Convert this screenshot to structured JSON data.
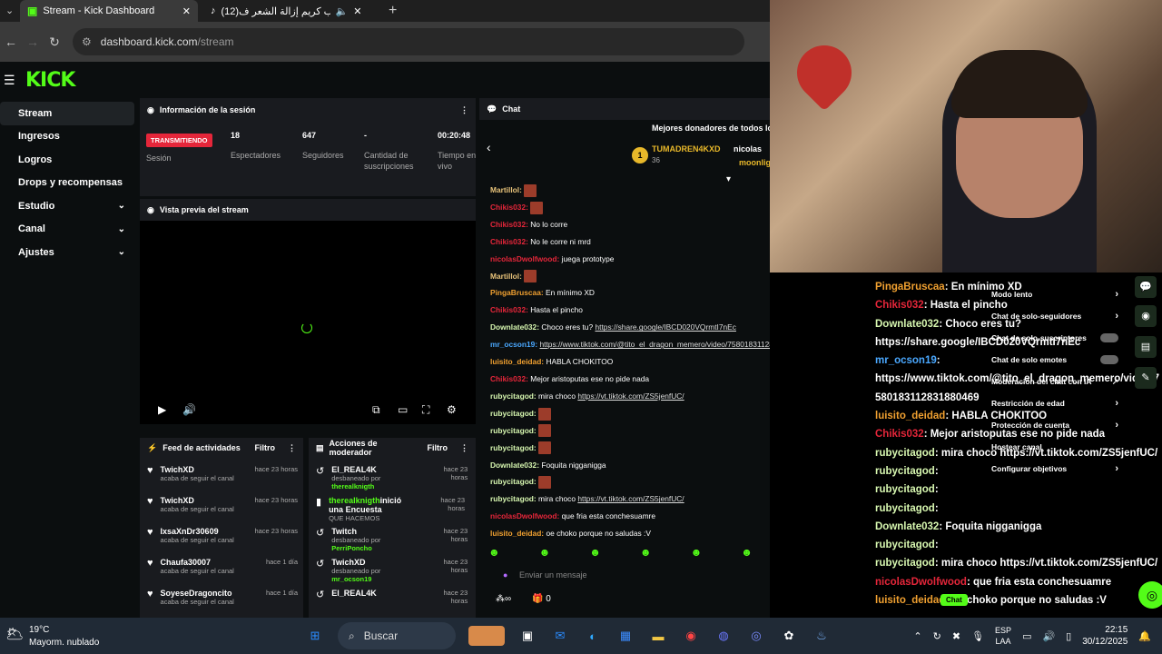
{
  "browser": {
    "tabs": [
      {
        "title": "Stream - Kick Dashboard",
        "active": true
      },
      {
        "title": "(12)مقلب كريم إزالة الشعر ف",
        "active": false
      }
    ],
    "url_domain": "dashboard.kick.com",
    "url_path": "/stream"
  },
  "app": {
    "logo": "KICK",
    "sidebar": [
      {
        "label": "Stream",
        "active": true,
        "expand": false
      },
      {
        "label": "Ingresos",
        "expand": false
      },
      {
        "label": "Logros",
        "expand": false
      },
      {
        "label": "Drops y recompensas",
        "expand": false
      },
      {
        "label": "Estudio",
        "expand": true
      },
      {
        "label": "Canal",
        "expand": true
      },
      {
        "label": "Ajustes",
        "expand": true
      }
    ]
  },
  "session": {
    "title": "Información de la sesión",
    "badge": "TRANSMITIENDO",
    "stats": [
      {
        "value": "18",
        "label": "Espectadores"
      },
      {
        "value": "647",
        "label": "Seguidores"
      },
      {
        "value": "-",
        "label": "Cantidad de suscripciones"
      },
      {
        "value": "00:20:48",
        "label": "Tiempo en vivo"
      }
    ],
    "session_label": "Sesión"
  },
  "preview": {
    "title": "Vista previa del stream"
  },
  "activity": {
    "title": "Feed de actividades",
    "filter": "Filtro",
    "items": [
      {
        "name": "TwichXD",
        "text": "acaba de seguir el canal",
        "time": "hace 23 horas"
      },
      {
        "name": "TwichXD",
        "text": "acaba de seguir el canal",
        "time": "hace 23 horas"
      },
      {
        "name": "IxsaXnDr30609",
        "text": "acaba de seguir el canal",
        "time": "hace 23 horas"
      },
      {
        "name": "Chaufa30007",
        "text": "acaba de seguir el canal",
        "time": "hace 1 día"
      },
      {
        "name": "SoyeseDragoncito",
        "text": "acaba de seguir el canal",
        "time": "hace 1 día"
      }
    ]
  },
  "moderator": {
    "title": "Acciones de moderador",
    "filter": "Filtro",
    "items": [
      {
        "name": "El_REAL4K",
        "text": "desbaneado por",
        "by": "therealknigth",
        "time": "hace 23 horas"
      },
      {
        "name": "therealknigth",
        "extra": "inició una Encuesta",
        "text": "QUE HACEMOS",
        "by": "",
        "time": "hace 23 horas"
      },
      {
        "name": "Twitch",
        "text": "desbaneado por",
        "by": "PerriPoncho",
        "time": "hace 23 horas"
      },
      {
        "name": "TwichXD",
        "text": "desbaneado por",
        "by": "mr_ocson19",
        "time": "hace 23 horas"
      },
      {
        "name": "El_REAL4K",
        "text": "",
        "by": "",
        "time": "hace 23 horas"
      }
    ]
  },
  "chat": {
    "title": "Chat",
    "donors_title": "Mejores donadores de todos lo",
    "donor1": "TUMADREN4KXD",
    "donor1_amount": "36",
    "donor2": "nicolas",
    "donor3": "moonlig",
    "lines": [
      {
        "user": "Martillol:",
        "color": "#e8c37a",
        "text": "",
        "emote": true
      },
      {
        "user": "Chikis032:",
        "color": "#e5263a",
        "text": "",
        "emote": true
      },
      {
        "user": "Chikis032:",
        "color": "#e5263a",
        "text": "No lo corre"
      },
      {
        "user": "Chikis032:",
        "color": "#e5263a",
        "text": "No le corre ni mrd"
      },
      {
        "user": "nicolasDwolfwood:",
        "color": "#e5263a",
        "text": "juega prototype"
      },
      {
        "user": "Martillol:",
        "color": "#e8c37a",
        "text": "",
        "emote": true
      },
      {
        "user": "PingaBruscaa:",
        "color": "#f0a030",
        "text": "En mínimo XD"
      },
      {
        "user": "Chikis032:",
        "color": "#e5263a",
        "text": "Hasta el pincho"
      },
      {
        "user": "Downlate032:",
        "color": "#d7f7b0",
        "text": "Choco eres tu?",
        "link": "https://share.google/IBCD020VQrmtI7nEc"
      },
      {
        "user": "mr_ocson19:",
        "color": "#4aa8ff",
        "text": "",
        "link": "https://www.tiktok.com/@tito_el_dragon_memero/video/7580183112831880469"
      },
      {
        "user": "luisito_deidad:",
        "color": "#f0a030",
        "text": "HABLA CHOKITOO"
      },
      {
        "user": "Chikis032:",
        "color": "#e5263a",
        "text": "Mejor aristoputas ese no pide nada"
      },
      {
        "user": "rubycitagod:",
        "color": "#d7f7b0",
        "text": "mira choco",
        "link": "https://vt.tiktok.com/ZS5jenfUC/"
      },
      {
        "user": "rubycitagod:",
        "color": "#d7f7b0",
        "text": "",
        "emote": true
      },
      {
        "user": "rubycitagod:",
        "color": "#d7f7b0",
        "text": "",
        "emote": true
      },
      {
        "user": "rubycitagod:",
        "color": "#d7f7b0",
        "text": "",
        "emote": true
      },
      {
        "user": "Downlate032:",
        "color": "#d7f7b0",
        "text": "Foquita nigganigga"
      },
      {
        "user": "rubycitagod:",
        "color": "#d7f7b0",
        "text": "",
        "emote": true
      },
      {
        "user": "rubycitagod:",
        "color": "#d7f7b0",
        "text": "mira choco",
        "link": "https://vt.tiktok.com/ZS5jenfUC/"
      },
      {
        "user": "nicolasDwolfwood:",
        "color": "#e5263a",
        "text": "que fria esta conchesuamre"
      },
      {
        "user": "luisito_deidad:",
        "color": "#f0a030",
        "text": "oe choko porque no saludas :V"
      }
    ],
    "input_placeholder": "Enviar un mensaje",
    "points": "0"
  },
  "overlay": {
    "lines": [
      {
        "user": "PingaBruscaa",
        "color": "#f0a030",
        "text": ": En mínimo XD"
      },
      {
        "user": "Chikis032",
        "color": "#e5263a",
        "text": ": Hasta el pincho"
      },
      {
        "user": "Downlate032",
        "color": "#d7f7b0",
        "text": ": Choco eres tu?"
      },
      {
        "user": "",
        "color": "#fff",
        "text": "https://share.google/IBCD020VQrmtI7nEc"
      },
      {
        "user": "mr_ocson19",
        "color": "#4aa8ff",
        "text": ":"
      },
      {
        "user": "",
        "color": "#fff",
        "text": "https://www.tiktok.com/@tito_el_dragon_memero/video/7"
      },
      {
        "user": "",
        "color": "#fff",
        "text": "580183112831880469"
      },
      {
        "user": "luisito_deidad",
        "color": "#f0a030",
        "text": ": HABLA CHOKITOO"
      },
      {
        "user": "Chikis032",
        "color": "#e5263a",
        "text": ": Mejor aristoputas ese no pide nada"
      },
      {
        "user": "rubycitagod",
        "color": "#d7f7b0",
        "text": ": mira choco https://vt.tiktok.com/ZS5jenfUC/"
      },
      {
        "user": "rubycitagod",
        "color": "#d7f7b0",
        "text": ":"
      },
      {
        "user": "rubycitagod",
        "color": "#d7f7b0",
        "text": ":"
      },
      {
        "user": "rubycitagod",
        "color": "#d7f7b0",
        "text": ":"
      },
      {
        "user": "Downlate032",
        "color": "#d7f7b0",
        "text": ": Foquita nigganigga"
      },
      {
        "user": "rubycitagod",
        "color": "#d7f7b0",
        "text": ":"
      },
      {
        "user": "rubycitagod",
        "color": "#d7f7b0",
        "text": ": mira choco https://vt.tiktok.com/ZS5jenfUC/"
      },
      {
        "user": "nicolasDwolfwood",
        "color": "#e5263a",
        "text": ": que fria esta conchesuamre"
      },
      {
        "user": "luisito_deidad",
        "color": "#f0a030",
        "text": ": oe choko porque no saludas :V"
      }
    ],
    "menu": [
      {
        "label": "Modo lento",
        "arrow": true
      },
      {
        "label": "Chat de solo-seguidores",
        "arrow": true
      },
      {
        "label": "Chat de solo-suscriptores",
        "toggle": true
      },
      {
        "label": "Chat de solo emotes",
        "toggle": true
      },
      {
        "label": "Moderación del chat con IA",
        "ext": true
      },
      {
        "label": "Restricción de edad",
        "arrow": true
      },
      {
        "label": "Protección de cuenta",
        "arrow": true
      },
      {
        "label": "Hostear canal",
        "arrow": false
      },
      {
        "label": "Configurar objetivos",
        "arrow": true
      }
    ],
    "chat_button": "Chat"
  },
  "taskbar": {
    "weather_temp": "19°C",
    "weather_desc": "Mayorm. nublado",
    "search": "Buscar",
    "lang1": "ESP",
    "lang2": "LAA",
    "time": "22:15",
    "date": "30/12/2025"
  }
}
